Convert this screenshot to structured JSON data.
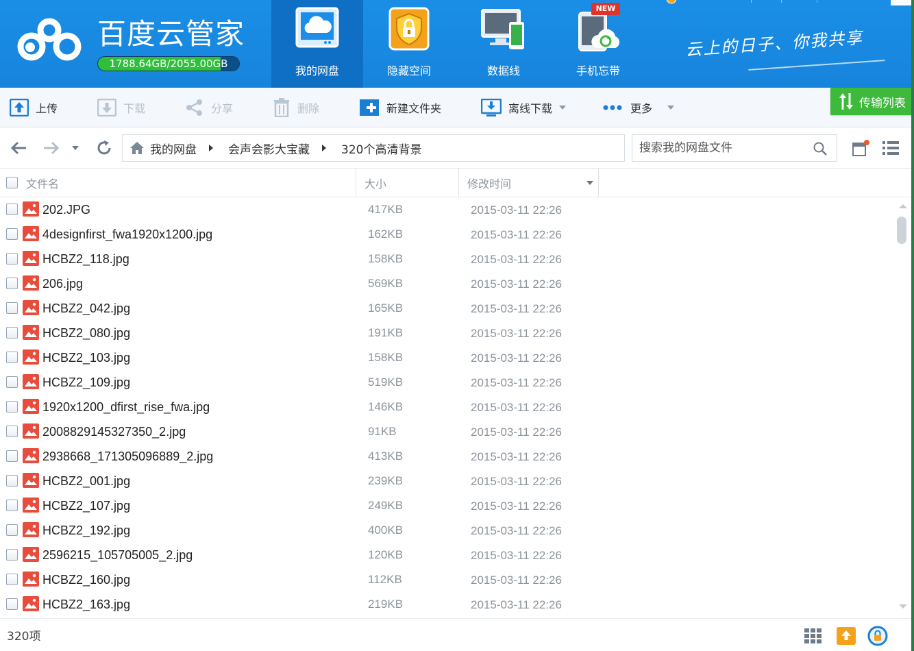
{
  "app": {
    "name": "百度云管家",
    "quota_text": "1788.64GB/2055.00GB",
    "quota_fraction": 0.87,
    "slogan": "云上的日子、你我共享"
  },
  "nav": [
    {
      "label": "我的网盘",
      "icon": "cloud-disk-icon",
      "active": true
    },
    {
      "label": "隐藏空间",
      "icon": "lock-icon",
      "active": false
    },
    {
      "label": "数据线",
      "icon": "devices-icon",
      "active": false
    },
    {
      "label": "手机忘带",
      "icon": "phone-sync-icon",
      "active": false,
      "badge": "NEW"
    }
  ],
  "toolbar": {
    "upload": "上传",
    "download": "下载",
    "share": "分享",
    "delete": "删除",
    "new_folder": "新建文件夹",
    "offline_download": "离线下载",
    "more": "更多",
    "transfer_list": "传输列表"
  },
  "address": {
    "breadcrumbs": [
      "我的网盘",
      "会声会影大宝藏",
      "320个高清背景"
    ],
    "search_placeholder": "搜索我的网盘文件"
  },
  "columns": {
    "name": "文件名",
    "size": "大小",
    "modified": "修改时间"
  },
  "files": [
    {
      "name": "202.JPG",
      "size": "417KB",
      "date": "2015-03-11 22:26"
    },
    {
      "name": "4designfirst_fwa1920x1200.jpg",
      "size": "162KB",
      "date": "2015-03-11 22:26"
    },
    {
      "name": "HCBZ2_118.jpg",
      "size": "158KB",
      "date": "2015-03-11 22:26"
    },
    {
      "name": "206.jpg",
      "size": "569KB",
      "date": "2015-03-11 22:26"
    },
    {
      "name": "HCBZ2_042.jpg",
      "size": "165KB",
      "date": "2015-03-11 22:26"
    },
    {
      "name": "HCBZ2_080.jpg",
      "size": "191KB",
      "date": "2015-03-11 22:26"
    },
    {
      "name": "HCBZ2_103.jpg",
      "size": "158KB",
      "date": "2015-03-11 22:26"
    },
    {
      "name": "HCBZ2_109.jpg",
      "size": "519KB",
      "date": "2015-03-11 22:26"
    },
    {
      "name": "1920x1200_dfirst_rise_fwa.jpg",
      "size": "146KB",
      "date": "2015-03-11 22:26"
    },
    {
      "name": "2008829145327350_2.jpg",
      "size": "91KB",
      "date": "2015-03-11 22:26"
    },
    {
      "name": "2938668_171305096889_2.jpg",
      "size": "413KB",
      "date": "2015-03-11 22:26"
    },
    {
      "name": "HCBZ2_001.jpg",
      "size": "239KB",
      "date": "2015-03-11 22:26"
    },
    {
      "name": "HCBZ2_107.jpg",
      "size": "249KB",
      "date": "2015-03-11 22:26"
    },
    {
      "name": "HCBZ2_192.jpg",
      "size": "400KB",
      "date": "2015-03-11 22:26"
    },
    {
      "name": "2596215_105705005_2.jpg",
      "size": "120KB",
      "date": "2015-03-11 22:26"
    },
    {
      "name": "HCBZ2_160.jpg",
      "size": "112KB",
      "date": "2015-03-11 22:26"
    },
    {
      "name": "HCBZ2_163.jpg",
      "size": "219KB",
      "date": "2015-03-11 22:26"
    }
  ],
  "status": {
    "item_count": "320项"
  },
  "colors": {
    "header_blue": "#1784dc",
    "active_nav": "#0f6fc4",
    "transfer_green": "#3db93b",
    "image_icon_red": "#e84c3d"
  }
}
